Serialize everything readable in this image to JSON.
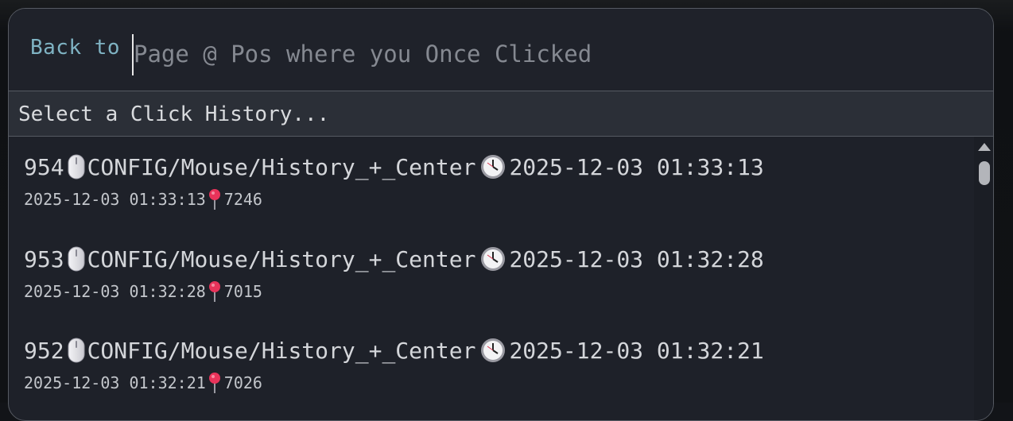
{
  "prompt": {
    "label": "Back to",
    "placeholder": "Page @ Pos where you Once Clicked"
  },
  "list_header": "Select a Click History...",
  "items": [
    {
      "id": "954",
      "path": "CONFIG/Mouse/History_+_Center",
      "datetime": "2025-12-03 01:33:13",
      "sub_datetime": "2025-12-03 01:33:13",
      "position": "7246"
    },
    {
      "id": "953",
      "path": "CONFIG/Mouse/History_+_Center",
      "datetime": "2025-12-03 01:32:28",
      "sub_datetime": "2025-12-03 01:32:28",
      "position": "7015"
    },
    {
      "id": "952",
      "path": "CONFIG/Mouse/History_+_Center",
      "datetime": "2025-12-03 01:32:21",
      "sub_datetime": "2025-12-03 01:32:21",
      "position": "7026"
    }
  ],
  "icons": {
    "item_type": "mouse-icon",
    "timestamp": "clock-icon",
    "position": "pin-icon"
  },
  "colors": {
    "prompt_label": "#7fb3c3",
    "placeholder": "#858991",
    "panel_bg": "#1e2129",
    "header_bg": "#2b2f37",
    "border": "#565a62",
    "item_text": "#d4d6da",
    "pin": "#e8335a"
  }
}
